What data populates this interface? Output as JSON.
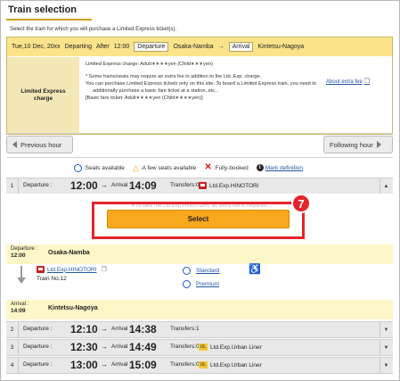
{
  "page": {
    "title": "Train selection",
    "instruction": "Select the train for which you will purchase a Limited Express ticket(s)."
  },
  "conditions": {
    "date": "Tue,10 Dec, 20xx",
    "departing_label": "Departing",
    "after_label": "After",
    "time": "12:00",
    "departure_chip": "Departure",
    "departure_station": "Osaka-Namba",
    "arrow": "→",
    "arrival_chip": "Arrival",
    "arrival_station": "Kintetsu-Nagoya",
    "charge_label_line1": "Limited Express",
    "charge_label_line2": "charge",
    "charge_line": "Limited Express charge: Adult∗∗∗∗yen (Child∗∗∗yen)",
    "note1": "* Some trains/seats may require an extra fee in addition to the Ltd. Exp. charge.",
    "extra_fee_link": "About extra fee",
    "note2": "You can purchase Limited Express tickets only on this site. To board a Limited Express train, you need to",
    "note3": "additionally purchase a basic fare ticket at a station, etc..",
    "note4": "[Basic fare ticket: Adult∗∗∗∗yen (Child∗∗∗∗yen)]"
  },
  "nav": {
    "prev_label": "Previous hour",
    "next_label": "Following hour"
  },
  "legend": {
    "available": ":Seats available",
    "few": ":A few seats available",
    "booked": ":Fully-booked",
    "mark_definition": "Mark definition"
  },
  "labels": {
    "departure": "Departure :",
    "arrival": "Arrival :",
    "transfers_prefix": "Transfers:"
  },
  "trains": [
    {
      "num": "1",
      "dep": "12:00",
      "arr": "14:09",
      "transfers": "Transfers:0",
      "name": "Ltd.Exp.HINOTORI",
      "icon": "ltd-express-icon",
      "expanded": true
    },
    {
      "num": "2",
      "dep": "12:10",
      "arr": "14:38",
      "transfers": "Transfers:1",
      "name": "",
      "icon": "",
      "expanded": false
    },
    {
      "num": "3",
      "dep": "12:30",
      "arr": "14:49",
      "transfers": "Transfers:0",
      "name": "Ltd.Exp.Urban Liner",
      "icon": "urban-liner-icon",
      "expanded": false
    },
    {
      "num": "4",
      "dep": "13:00",
      "arr": "15:09",
      "transfers": "Transfers:0",
      "name": "Ltd.Exp.Urban Liner",
      "icon": "urban-liner-icon",
      "expanded": false
    }
  ],
  "detail": {
    "faded_note": "∗To take the Ltd.Exp.HINOTORI, an extra fee is required...",
    "select_label": "Select",
    "callout_number": "7",
    "departure_label": "Departure :",
    "departure_time": "12:00",
    "departure_station": "Osaka-Namba",
    "train_name": "Ltd.Exp.HINOTORI",
    "train_no": "Train No.12",
    "seat_standard": "Standard",
    "seat_premium": "Premium",
    "arrival_label": "Arrival :",
    "arrival_time": "14:09",
    "arrival_station": "Kintetsu-Nagoya"
  },
  "colors": {
    "accent_gold": "#c9a21c",
    "select_button": "#f7a81c",
    "callout_red": "#e5232b",
    "link_blue": "#2455a8"
  }
}
